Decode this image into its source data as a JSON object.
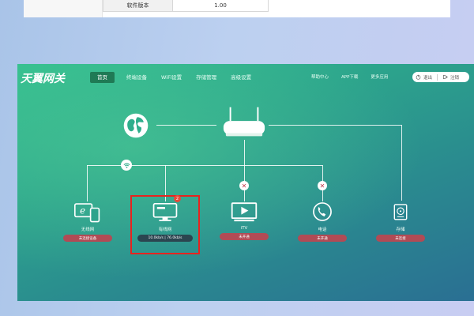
{
  "info_table": {
    "row_key": "软件版本",
    "row_value": "1.00"
  },
  "app": {
    "logo_text": "天翼网关",
    "nav": [
      {
        "label": "首页",
        "active": true
      },
      {
        "label": "终端设备",
        "active": false
      },
      {
        "label": "WiFi设置",
        "active": false
      },
      {
        "label": "存储管理",
        "active": false
      },
      {
        "label": "高级设置",
        "active": false
      }
    ],
    "top_links": [
      "帮助中心",
      "APP下载",
      "更多应用"
    ],
    "user_pill": {
      "left_label": "退出",
      "right_label": "注销"
    }
  },
  "devices": {
    "wireless": {
      "label": "无线网",
      "status": "未连接设备"
    },
    "wired": {
      "label": "有线网",
      "status": "10.0kb/s | 76.0kb/s",
      "alert_count": "2"
    },
    "itv": {
      "label": "iTV",
      "status": "未开通"
    },
    "phone": {
      "label": "电话",
      "status": "未开通"
    },
    "storage": {
      "label": "存储",
      "status": "未连接"
    }
  },
  "colors": {
    "accent_green": "#34bf8f",
    "badge_red": "#b14b55",
    "badge_dark": "#2b4550",
    "highlight_red": "#e8231f"
  },
  "icons": [
    "globe-icon",
    "router-icon",
    "wifi-icon",
    "ie-phone-icon",
    "monitor-icon",
    "tv-play-icon",
    "phone-icon",
    "storage-icon",
    "close-icon",
    "power-icon",
    "logout-icon"
  ]
}
